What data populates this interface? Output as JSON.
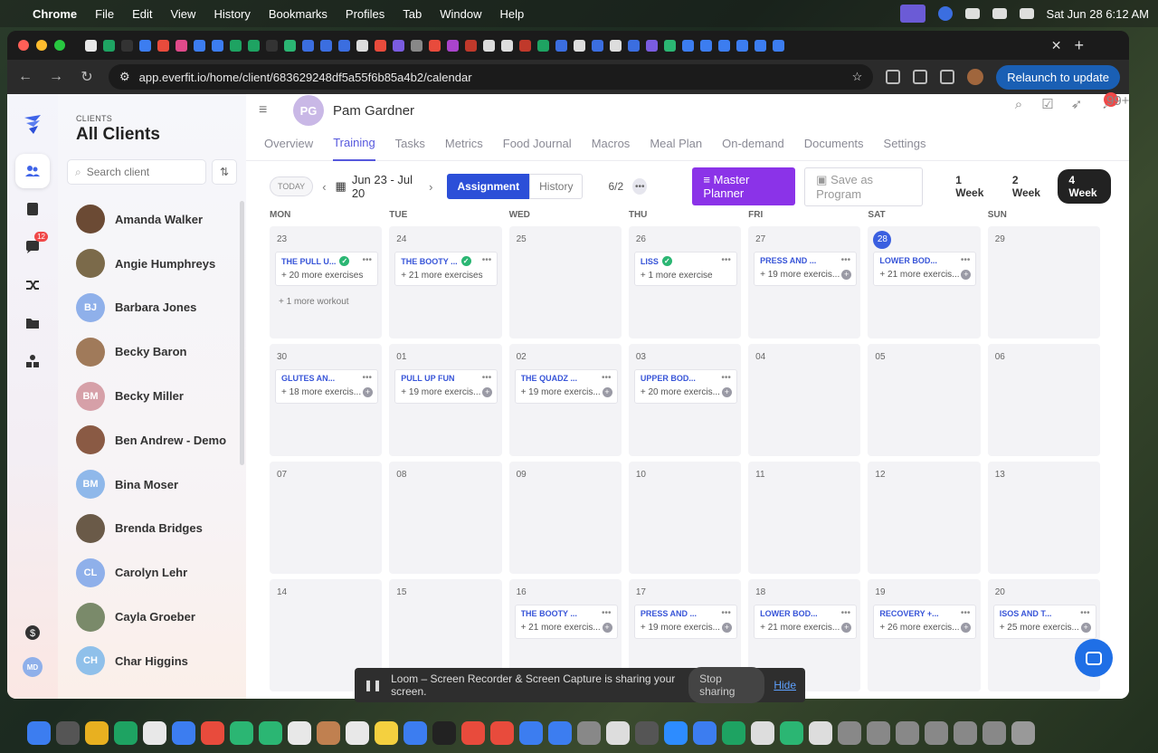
{
  "menubar": {
    "app": "Chrome",
    "items": [
      "File",
      "Edit",
      "View",
      "History",
      "Bookmarks",
      "Profiles",
      "Tab",
      "Window",
      "Help"
    ],
    "datetime": "Sat Jun 28  6:12 AM"
  },
  "browser": {
    "url": "app.everfit.io/home/client/683629248df5a55f6b85a4b2/calendar",
    "relaunch": "Relaunch to update"
  },
  "sidebar": {
    "caption": "CLIENTS",
    "heading": "All Clients",
    "search_placeholder": "Search client",
    "clients": [
      {
        "name": "Amanda Walker",
        "initials": "",
        "color": "#6b4a34"
      },
      {
        "name": "Angie Humphreys",
        "initials": "",
        "color": "#7b6a4a"
      },
      {
        "name": "Barbara Jones",
        "initials": "BJ",
        "color": "#8fb0ea"
      },
      {
        "name": "Becky Baron",
        "initials": "",
        "color": "#a07a5a"
      },
      {
        "name": "Becky Miller",
        "initials": "BM",
        "color": "#d6a0a8"
      },
      {
        "name": "Ben Andrew - Demo",
        "initials": "",
        "color": "#8a5a44"
      },
      {
        "name": "Bina Moser",
        "initials": "BM",
        "color": "#8fb8ea"
      },
      {
        "name": "Brenda Bridges",
        "initials": "",
        "color": "#6a5a48"
      },
      {
        "name": "Carolyn Lehr",
        "initials": "CL",
        "color": "#8fb0ea"
      },
      {
        "name": "Cayla Groeber",
        "initials": "",
        "color": "#7a8a6a"
      },
      {
        "name": "Char Higgins",
        "initials": "CH",
        "color": "#8fc0ea"
      }
    ]
  },
  "rail": {
    "messages_badge": "12",
    "user_initials": "MD"
  },
  "client": {
    "initials": "PG",
    "name": "Pam Gardner",
    "notif_badge": "99+"
  },
  "tabs": [
    "Overview",
    "Training",
    "Tasks",
    "Metrics",
    "Food Journal",
    "Macros",
    "Meal Plan",
    "On-demand",
    "Documents",
    "Settings"
  ],
  "active_tab": "Training",
  "controls": {
    "today": "TODAY",
    "range": "Jun 23 - Jul 20",
    "assignment": "Assignment",
    "history": "History",
    "pager": "6/2",
    "master_planner": "Master Planner",
    "save_program": "Save as Program",
    "weeks": [
      "1 Week",
      "2 Week",
      "4 Week"
    ],
    "active_week": "4 Week"
  },
  "calendar": {
    "days_of_week": [
      "MON",
      "TUE",
      "WED",
      "THU",
      "FRI",
      "SAT",
      "SUN"
    ],
    "weeks": [
      [
        {
          "date": "23",
          "workout": "THE PULL U...",
          "done": true,
          "more": "+ 20 more exercises",
          "extra": "+ 1 more workout"
        },
        {
          "date": "24",
          "workout": "THE BOOTY ...",
          "done": true,
          "more": "+ 21 more exercises"
        },
        {
          "date": "25"
        },
        {
          "date": "26",
          "workout": "LISS",
          "done": true,
          "more": "+ 1 more exercise"
        },
        {
          "date": "27",
          "workout": "PRESS AND ...",
          "more": "+ 19 more exercis...",
          "plus": true
        },
        {
          "date": "28",
          "today": true,
          "workout": "LOWER BOD...",
          "more": "+ 21 more exercis...",
          "plus": true
        },
        {
          "date": "29"
        }
      ],
      [
        {
          "date": "30",
          "workout": "GLUTES AN...",
          "more": "+ 18 more exercis...",
          "plus": true
        },
        {
          "date": "01",
          "workout": "PULL UP FUN",
          "more": "+ 19 more exercis...",
          "plus": true
        },
        {
          "date": "02",
          "workout": "THE QUADZ ...",
          "more": "+ 19 more exercis...",
          "plus": true
        },
        {
          "date": "03",
          "workout": "UPPER BOD...",
          "more": "+ 20 more exercis...",
          "plus": true
        },
        {
          "date": "04"
        },
        {
          "date": "05"
        },
        {
          "date": "06"
        }
      ],
      [
        {
          "date": "07"
        },
        {
          "date": "08"
        },
        {
          "date": "09"
        },
        {
          "date": "10"
        },
        {
          "date": "11"
        },
        {
          "date": "12"
        },
        {
          "date": "13"
        }
      ],
      [
        {
          "date": "14"
        },
        {
          "date": "15"
        },
        {
          "date": "16",
          "workout": "THE BOOTY ...",
          "more": "+ 21 more exercis...",
          "plus": true
        },
        {
          "date": "17",
          "workout": "PRESS AND ...",
          "more": "+ 19 more exercis...",
          "plus": true
        },
        {
          "date": "18",
          "workout": "LOWER BOD...",
          "more": "+ 21 more exercis...",
          "plus": true
        },
        {
          "date": "19",
          "workout": "RECOVERY +...",
          "more": "+ 26 more exercis...",
          "plus": true
        },
        {
          "date": "20",
          "workout": "ISOS AND T...",
          "more": "+ 25 more exercis...",
          "plus": true
        }
      ]
    ]
  },
  "loom": {
    "message": "Loom – Screen Recorder & Screen Capture is sharing your screen.",
    "stop": "Stop sharing",
    "hide": "Hide"
  },
  "colors": {
    "accent": "#5658dd",
    "primary_button": "#2c4fd8",
    "master_planner": "#8b33e8",
    "done": "#2bb673"
  }
}
